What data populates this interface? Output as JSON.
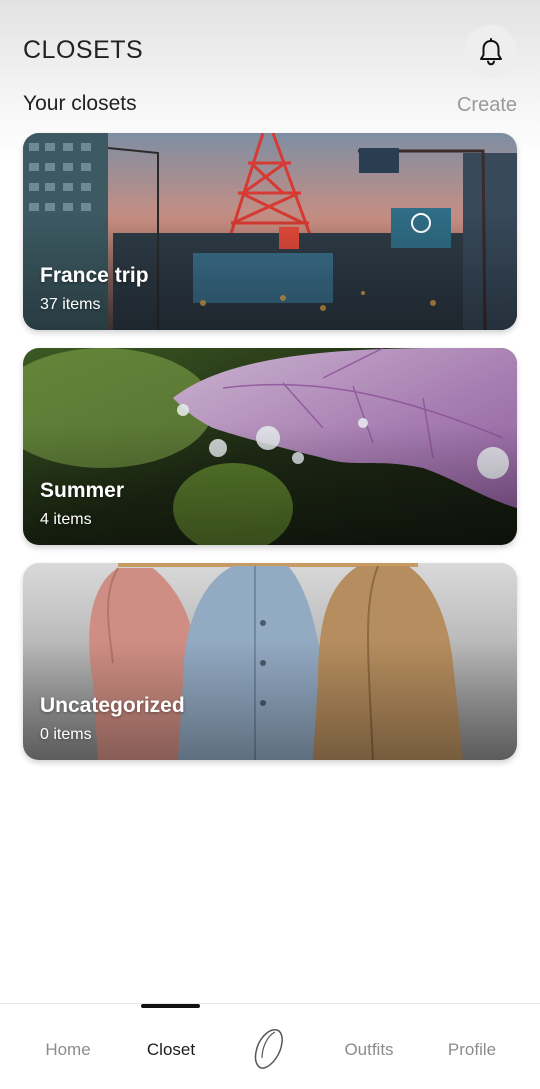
{
  "header": {
    "title": "CLOSETS",
    "notification_icon": "bell-icon"
  },
  "section": {
    "heading": "Your closets",
    "create_label": "Create"
  },
  "closets": [
    {
      "name": "France trip",
      "count": "37 items",
      "image": "city-tower-street-photo"
    },
    {
      "name": "Summer",
      "count": "4 items",
      "image": "leaf-water-droplets-photo"
    },
    {
      "name": "Uncategorized",
      "count": "0 items",
      "image": "hanging-jackets-photo"
    }
  ],
  "nav": {
    "items": [
      {
        "label": "Home",
        "active": false
      },
      {
        "label": "Closet",
        "active": true
      },
      {
        "label": "",
        "icon": "app-logo-icon"
      },
      {
        "label": "Outfits",
        "active": false
      },
      {
        "label": "Profile",
        "active": false
      }
    ]
  }
}
